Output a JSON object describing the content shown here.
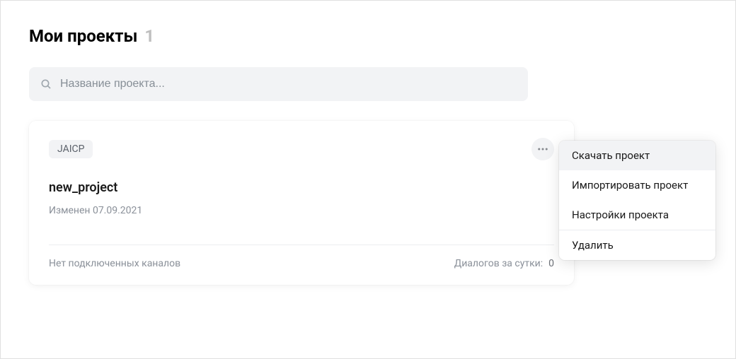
{
  "header": {
    "title": "Мои проекты",
    "count": "1"
  },
  "search": {
    "placeholder": "Название проекта..."
  },
  "project": {
    "tag": "JAICP",
    "name": "new_project",
    "modified": "Изменен 07.09.2021",
    "no_channels": "Нет подключенных каналов",
    "dialogs_label": "Диалогов за сутки:",
    "dialogs_count": "0"
  },
  "menu": {
    "download": "Скачать проект",
    "import": "Импортировать проект",
    "settings": "Настройки проекта",
    "delete": "Удалить"
  }
}
